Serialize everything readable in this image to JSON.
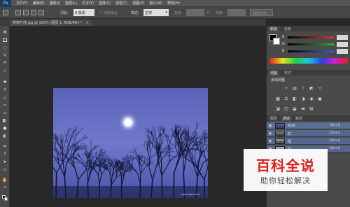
{
  "app": {
    "logo": "Ps"
  },
  "menu": [
    "文件(F)",
    "编辑(E)",
    "图像(I)",
    "图层(L)",
    "文字(Y)",
    "选择(S)",
    "滤镜(T)",
    "视图(V)",
    "窗口(W)",
    "帮助(H)"
  ],
  "options": {
    "feather_label": "羽化:",
    "feather_value": "0 像素",
    "antialias_label": "消除锯齿",
    "style_label": "样式:",
    "style_value": "正常",
    "width_label": "宽度:",
    "height_label": "高度:",
    "refine_edge_button": "调整边缘..."
  },
  "document_tab": {
    "title": "林絮叶茂.jpg @ 100% (图层 1, RGB/8#) *",
    "close": "×"
  },
  "color_panel": {
    "tabs": [
      "颜色",
      "色板"
    ],
    "channels": [
      {
        "label": "R",
        "color": "#d23a3a"
      },
      {
        "label": "G",
        "color": "#2fae3a"
      },
      {
        "label": "B",
        "color": "#3b5cd8"
      }
    ]
  },
  "adjustments_panel": {
    "tabs": [
      "调整",
      "样式"
    ],
    "heading": "添加调整",
    "icons_row1": [
      "brightness-icon",
      "levels-icon",
      "curves-icon",
      "exposure-icon"
    ],
    "icons_row2": [
      "vibrance-icon",
      "hue-icon",
      "color-balance-icon",
      "bw-icon",
      "photo-filter-icon",
      "channel-mixer-icon",
      "color-lookup-icon"
    ],
    "icons_row3": [
      "invert-icon",
      "posterize-icon",
      "threshold-icon",
      "gradient-map-icon",
      "selective-color-icon"
    ]
  },
  "channels_panel": {
    "tabs": [
      "图层",
      "通道",
      "路径"
    ],
    "channels": [
      {
        "name": "RGB",
        "shortcut": "Ctrl+2"
      },
      {
        "name": "红",
        "shortcut": "Ctrl+3"
      },
      {
        "name": "绿",
        "shortcut": "Ctrl+4"
      },
      {
        "name": "蓝",
        "shortcut": "Ctrl+5"
      }
    ]
  },
  "canvas": {
    "watermark_url": "www.nipic.com"
  },
  "watermark_logo": {
    "title": "百科全说",
    "subtitle": "助你轻松解决"
  },
  "colors": {
    "background": "#282828",
    "menu_bg": "#535353",
    "panel_bg": "#4a4a4a",
    "sky": "#6570c4",
    "brand_red": "#e02020"
  }
}
